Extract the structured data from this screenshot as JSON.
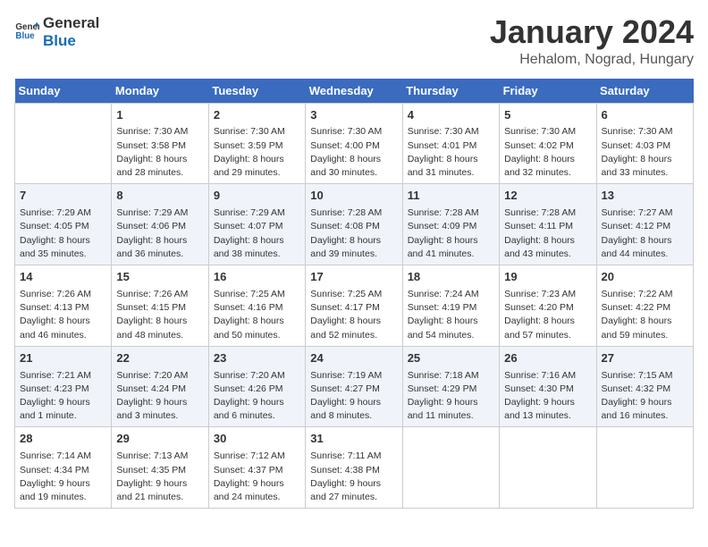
{
  "header": {
    "logo_general": "General",
    "logo_blue": "Blue",
    "month": "January 2024",
    "location": "Hehalom, Nograd, Hungary"
  },
  "weekdays": [
    "Sunday",
    "Monday",
    "Tuesday",
    "Wednesday",
    "Thursday",
    "Friday",
    "Saturday"
  ],
  "weeks": [
    [
      {
        "day": "",
        "sunrise": "",
        "sunset": "",
        "daylight": ""
      },
      {
        "day": "1",
        "sunrise": "Sunrise: 7:30 AM",
        "sunset": "Sunset: 3:58 PM",
        "daylight": "Daylight: 8 hours and 28 minutes."
      },
      {
        "day": "2",
        "sunrise": "Sunrise: 7:30 AM",
        "sunset": "Sunset: 3:59 PM",
        "daylight": "Daylight: 8 hours and 29 minutes."
      },
      {
        "day": "3",
        "sunrise": "Sunrise: 7:30 AM",
        "sunset": "Sunset: 4:00 PM",
        "daylight": "Daylight: 8 hours and 30 minutes."
      },
      {
        "day": "4",
        "sunrise": "Sunrise: 7:30 AM",
        "sunset": "Sunset: 4:01 PM",
        "daylight": "Daylight: 8 hours and 31 minutes."
      },
      {
        "day": "5",
        "sunrise": "Sunrise: 7:30 AM",
        "sunset": "Sunset: 4:02 PM",
        "daylight": "Daylight: 8 hours and 32 minutes."
      },
      {
        "day": "6",
        "sunrise": "Sunrise: 7:30 AM",
        "sunset": "Sunset: 4:03 PM",
        "daylight": "Daylight: 8 hours and 33 minutes."
      }
    ],
    [
      {
        "day": "7",
        "sunrise": "Sunrise: 7:29 AM",
        "sunset": "Sunset: 4:05 PM",
        "daylight": "Daylight: 8 hours and 35 minutes."
      },
      {
        "day": "8",
        "sunrise": "Sunrise: 7:29 AM",
        "sunset": "Sunset: 4:06 PM",
        "daylight": "Daylight: 8 hours and 36 minutes."
      },
      {
        "day": "9",
        "sunrise": "Sunrise: 7:29 AM",
        "sunset": "Sunset: 4:07 PM",
        "daylight": "Daylight: 8 hours and 38 minutes."
      },
      {
        "day": "10",
        "sunrise": "Sunrise: 7:28 AM",
        "sunset": "Sunset: 4:08 PM",
        "daylight": "Daylight: 8 hours and 39 minutes."
      },
      {
        "day": "11",
        "sunrise": "Sunrise: 7:28 AM",
        "sunset": "Sunset: 4:09 PM",
        "daylight": "Daylight: 8 hours and 41 minutes."
      },
      {
        "day": "12",
        "sunrise": "Sunrise: 7:28 AM",
        "sunset": "Sunset: 4:11 PM",
        "daylight": "Daylight: 8 hours and 43 minutes."
      },
      {
        "day": "13",
        "sunrise": "Sunrise: 7:27 AM",
        "sunset": "Sunset: 4:12 PM",
        "daylight": "Daylight: 8 hours and 44 minutes."
      }
    ],
    [
      {
        "day": "14",
        "sunrise": "Sunrise: 7:26 AM",
        "sunset": "Sunset: 4:13 PM",
        "daylight": "Daylight: 8 hours and 46 minutes."
      },
      {
        "day": "15",
        "sunrise": "Sunrise: 7:26 AM",
        "sunset": "Sunset: 4:15 PM",
        "daylight": "Daylight: 8 hours and 48 minutes."
      },
      {
        "day": "16",
        "sunrise": "Sunrise: 7:25 AM",
        "sunset": "Sunset: 4:16 PM",
        "daylight": "Daylight: 8 hours and 50 minutes."
      },
      {
        "day": "17",
        "sunrise": "Sunrise: 7:25 AM",
        "sunset": "Sunset: 4:17 PM",
        "daylight": "Daylight: 8 hours and 52 minutes."
      },
      {
        "day": "18",
        "sunrise": "Sunrise: 7:24 AM",
        "sunset": "Sunset: 4:19 PM",
        "daylight": "Daylight: 8 hours and 54 minutes."
      },
      {
        "day": "19",
        "sunrise": "Sunrise: 7:23 AM",
        "sunset": "Sunset: 4:20 PM",
        "daylight": "Daylight: 8 hours and 57 minutes."
      },
      {
        "day": "20",
        "sunrise": "Sunrise: 7:22 AM",
        "sunset": "Sunset: 4:22 PM",
        "daylight": "Daylight: 8 hours and 59 minutes."
      }
    ],
    [
      {
        "day": "21",
        "sunrise": "Sunrise: 7:21 AM",
        "sunset": "Sunset: 4:23 PM",
        "daylight": "Daylight: 9 hours and 1 minute."
      },
      {
        "day": "22",
        "sunrise": "Sunrise: 7:20 AM",
        "sunset": "Sunset: 4:24 PM",
        "daylight": "Daylight: 9 hours and 3 minutes."
      },
      {
        "day": "23",
        "sunrise": "Sunrise: 7:20 AM",
        "sunset": "Sunset: 4:26 PM",
        "daylight": "Daylight: 9 hours and 6 minutes."
      },
      {
        "day": "24",
        "sunrise": "Sunrise: 7:19 AM",
        "sunset": "Sunset: 4:27 PM",
        "daylight": "Daylight: 9 hours and 8 minutes."
      },
      {
        "day": "25",
        "sunrise": "Sunrise: 7:18 AM",
        "sunset": "Sunset: 4:29 PM",
        "daylight": "Daylight: 9 hours and 11 minutes."
      },
      {
        "day": "26",
        "sunrise": "Sunrise: 7:16 AM",
        "sunset": "Sunset: 4:30 PM",
        "daylight": "Daylight: 9 hours and 13 minutes."
      },
      {
        "day": "27",
        "sunrise": "Sunrise: 7:15 AM",
        "sunset": "Sunset: 4:32 PM",
        "daylight": "Daylight: 9 hours and 16 minutes."
      }
    ],
    [
      {
        "day": "28",
        "sunrise": "Sunrise: 7:14 AM",
        "sunset": "Sunset: 4:34 PM",
        "daylight": "Daylight: 9 hours and 19 minutes."
      },
      {
        "day": "29",
        "sunrise": "Sunrise: 7:13 AM",
        "sunset": "Sunset: 4:35 PM",
        "daylight": "Daylight: 9 hours and 21 minutes."
      },
      {
        "day": "30",
        "sunrise": "Sunrise: 7:12 AM",
        "sunset": "Sunset: 4:37 PM",
        "daylight": "Daylight: 9 hours and 24 minutes."
      },
      {
        "day": "31",
        "sunrise": "Sunrise: 7:11 AM",
        "sunset": "Sunset: 4:38 PM",
        "daylight": "Daylight: 9 hours and 27 minutes."
      },
      {
        "day": "",
        "sunrise": "",
        "sunset": "",
        "daylight": ""
      },
      {
        "day": "",
        "sunrise": "",
        "sunset": "",
        "daylight": ""
      },
      {
        "day": "",
        "sunrise": "",
        "sunset": "",
        "daylight": ""
      }
    ]
  ]
}
